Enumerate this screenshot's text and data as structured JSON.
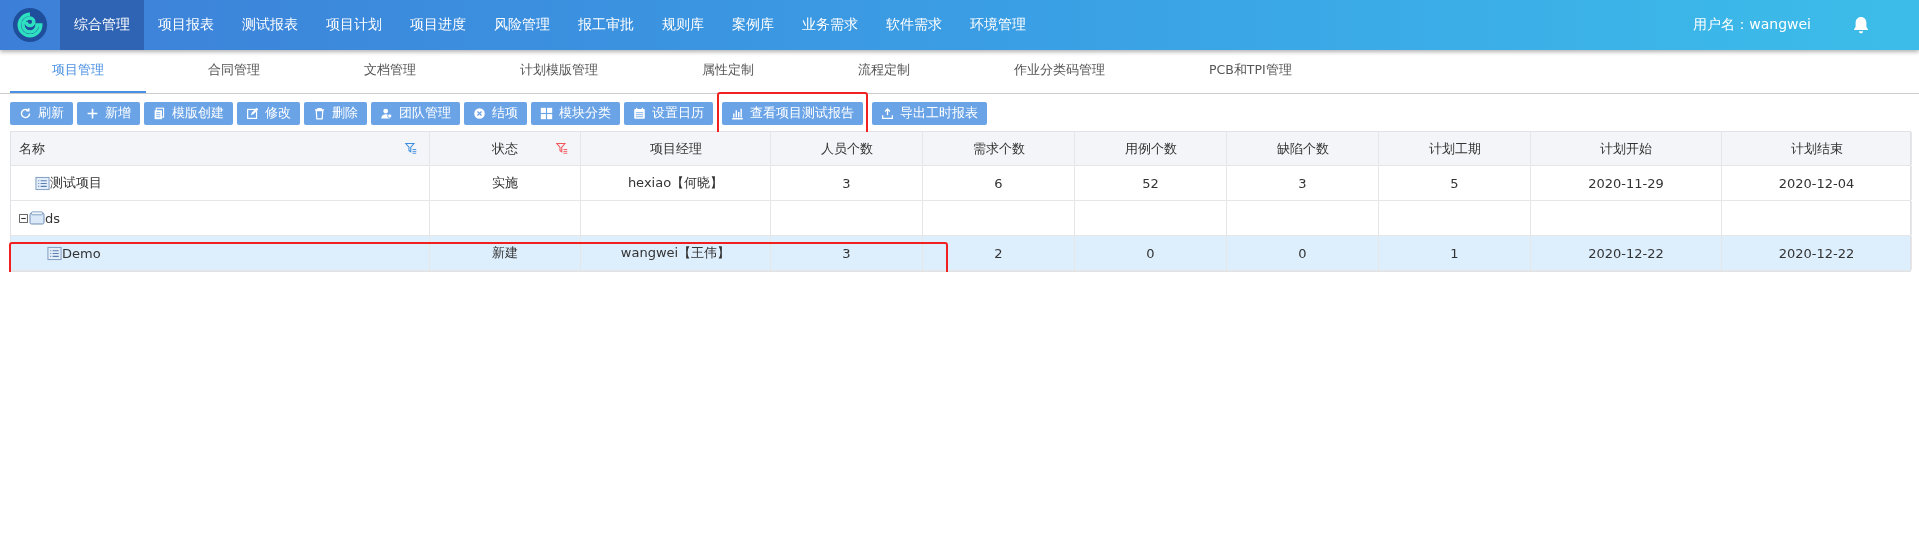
{
  "nav": {
    "items": [
      {
        "label": "综合管理",
        "selected": true
      },
      {
        "label": "项目报表",
        "selected": false
      },
      {
        "label": "测试报表",
        "selected": false
      },
      {
        "label": "项目计划",
        "selected": false
      },
      {
        "label": "项目进度",
        "selected": false
      },
      {
        "label": "风险管理",
        "selected": false
      },
      {
        "label": "报工审批",
        "selected": false
      },
      {
        "label": "规则库",
        "selected": false
      },
      {
        "label": "案例库",
        "selected": false
      },
      {
        "label": "业务需求",
        "selected": false
      },
      {
        "label": "软件需求",
        "selected": false
      },
      {
        "label": "环境管理",
        "selected": false
      }
    ],
    "user": "用户名：wangwei"
  },
  "tabs": [
    {
      "label": "项目管理",
      "selected": true
    },
    {
      "label": "合同管理",
      "selected": false
    },
    {
      "label": "文档管理",
      "selected": false
    },
    {
      "label": "计划模版管理",
      "selected": false
    },
    {
      "label": "属性定制",
      "selected": false
    },
    {
      "label": "流程定制",
      "selected": false
    },
    {
      "label": "作业分类码管理",
      "selected": false
    },
    {
      "label": "PCB和TPI管理",
      "selected": false
    }
  ],
  "toolbar": [
    {
      "label": "刷新"
    },
    {
      "label": "新增"
    },
    {
      "label": "模版创建"
    },
    {
      "label": "修改"
    },
    {
      "label": "删除"
    },
    {
      "label": "团队管理"
    },
    {
      "label": "结项"
    },
    {
      "label": "模块分类"
    },
    {
      "label": "设置日历"
    },
    {
      "label": "查看项目测试报告",
      "highlighted": true
    },
    {
      "label": "导出工时报表"
    }
  ],
  "table": {
    "columns": [
      {
        "label": "名称",
        "filter_active": false
      },
      {
        "label": "状态",
        "filter_active": true
      },
      {
        "label": "项目经理"
      },
      {
        "label": "人员个数"
      },
      {
        "label": "需求个数"
      },
      {
        "label": "用例个数"
      },
      {
        "label": "缺陷个数"
      },
      {
        "label": "计划工期"
      },
      {
        "label": "计划开始"
      },
      {
        "label": "计划结束"
      }
    ],
    "rows": [
      {
        "kind": "item",
        "selected": false,
        "cells": [
          "测试项目",
          "实施",
          "hexiao【何晓】",
          "3",
          "6",
          "52",
          "3",
          "5",
          "2020-11-29",
          "2020-12-04"
        ]
      },
      {
        "kind": "folder",
        "expanded": true,
        "selected": false,
        "cells": [
          "ds"
        ],
        "children": [
          {
            "kind": "item",
            "selected": true,
            "highlighted": true,
            "cells": [
              "Demo",
              "新建",
              "wangwei【王伟】",
              "3",
              "2",
              "0",
              "0",
              "1",
              "2020-12-22",
              "2020-12-22"
            ]
          }
        ]
      }
    ]
  }
}
